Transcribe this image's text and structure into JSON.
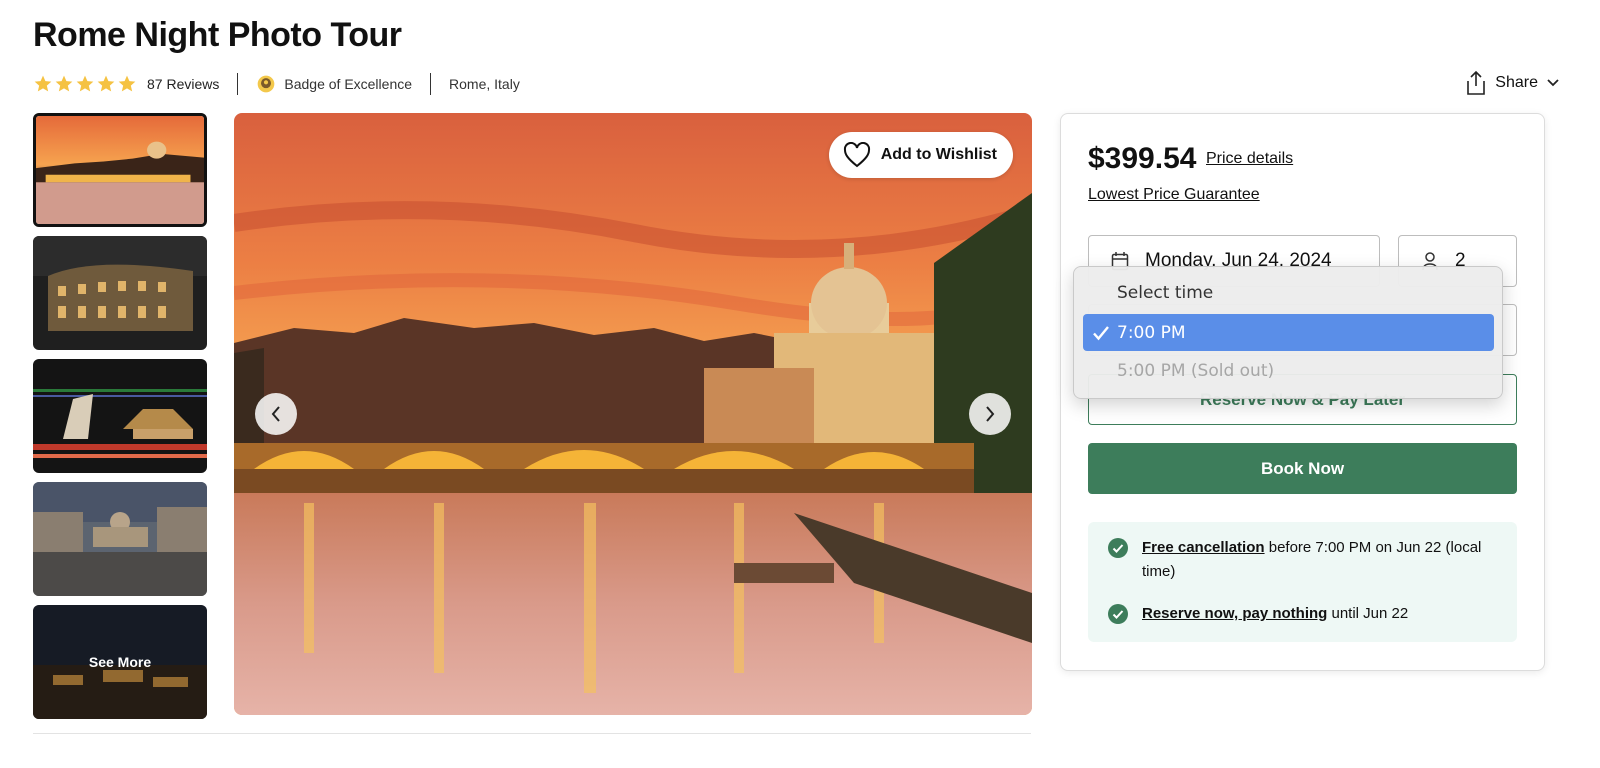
{
  "header": {
    "title": "Rome Night Photo Tour",
    "reviews": "87 Reviews",
    "badge": "Badge of Excellence",
    "location": "Rome, Italy",
    "rating": 5,
    "share_label": "Share"
  },
  "gallery": {
    "see_more": "See More",
    "wishlist_label": "Add to Wishlist",
    "thumbnails": [
      "st-peters-bridge-sunset",
      "colosseum-night",
      "castel-santangelo-light-trails",
      "st-peters-square-dusk",
      "rome-night-skyline"
    ]
  },
  "booking": {
    "price": "$399.54",
    "price_details": "Price details",
    "lowest_price": "Lowest Price Guarantee",
    "date": "Monday, Jun 24, 2024",
    "participants": "2",
    "reserve_label": "Reserve Now & Pay Later",
    "book_label": "Book Now",
    "free_cancel_link": "Free cancellation",
    "free_cancel_text": "before 7:00 PM on Jun 22 (local time)",
    "reserve_link": "Reserve now, pay nothing",
    "reserve_text": "until Jun 22"
  },
  "time_dropdown": {
    "header": "Select time",
    "options": [
      {
        "label": "7:00 PM",
        "selected": true
      },
      {
        "label": "5:00 PM (Sold out)",
        "disabled": true
      }
    ]
  },
  "colors": {
    "accent_green": "#3d7d5b",
    "info_bg": "#eef8f5",
    "star": "#f5c242",
    "selection_blue": "#5a8ee8"
  }
}
